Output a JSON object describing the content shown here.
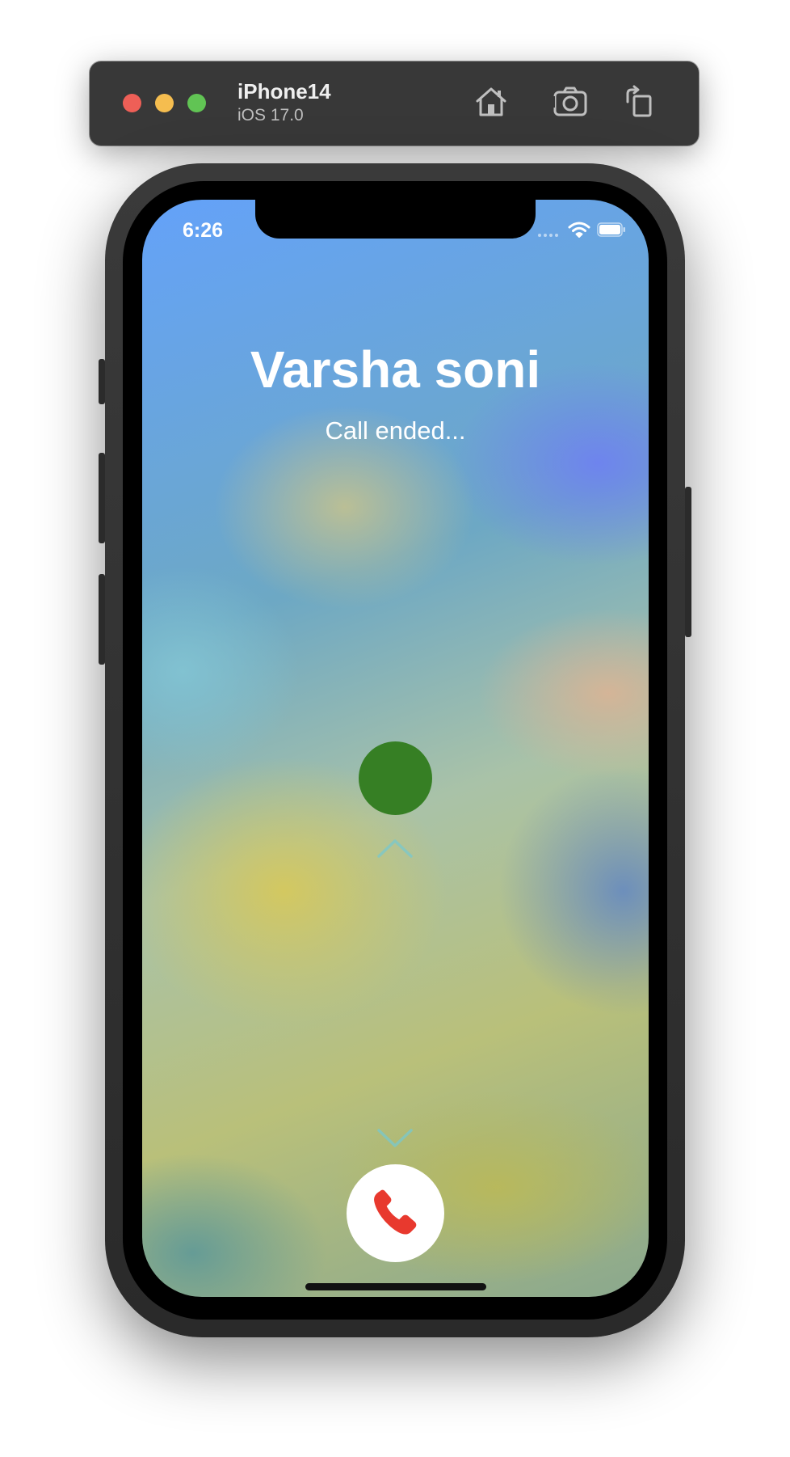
{
  "toolbar": {
    "device_name": "iPhone14",
    "os_version": "iOS 17.0",
    "buttons": [
      "home-icon",
      "screenshot-icon",
      "rotate-icon"
    ]
  },
  "status_bar": {
    "time": "6:26",
    "icons": [
      "signal-icon",
      "wifi-icon",
      "battery-icon"
    ]
  },
  "call": {
    "caller_name": "Varsha soni",
    "status": "Call ended..."
  },
  "controls": {
    "accept_indicator_color": "#367f24",
    "end_call_icon": "phone-hangup-icon",
    "end_call_color": "#e8392e"
  }
}
